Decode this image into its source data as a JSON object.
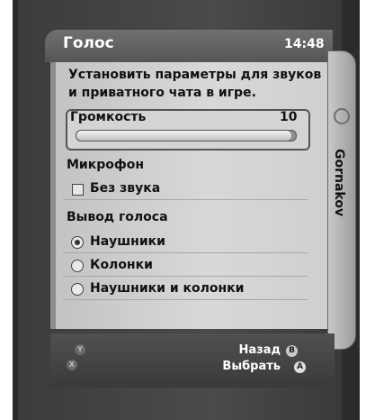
{
  "header": {
    "title": "Голос",
    "time": "14:48"
  },
  "description": "Установить параметры для звуков и приватного чата в игре.",
  "volume": {
    "label": "Громкость",
    "value": "10",
    "level_percent": 98
  },
  "microphone": {
    "label": "Микрофон",
    "mute": {
      "label": "Без звука",
      "checked": false
    }
  },
  "voice_output": {
    "label": "Вывод голоса",
    "options": [
      {
        "label": "Наушники",
        "selected": true
      },
      {
        "label": "Колонки",
        "selected": false
      },
      {
        "label": "Наушники и колонки",
        "selected": false
      }
    ]
  },
  "side_tab": {
    "label": "Gornakov"
  },
  "footer": {
    "back_label": "Назад",
    "select_label": "Выбрать",
    "back_button_glyph": "B",
    "select_button_glyph": "A",
    "ghost_y_glyph": "Y",
    "ghost_x_glyph": "X"
  },
  "colors": {
    "b_button": "#c8c8c8",
    "a_button": "#e0e0e0",
    "header_text": "#ffffff"
  }
}
